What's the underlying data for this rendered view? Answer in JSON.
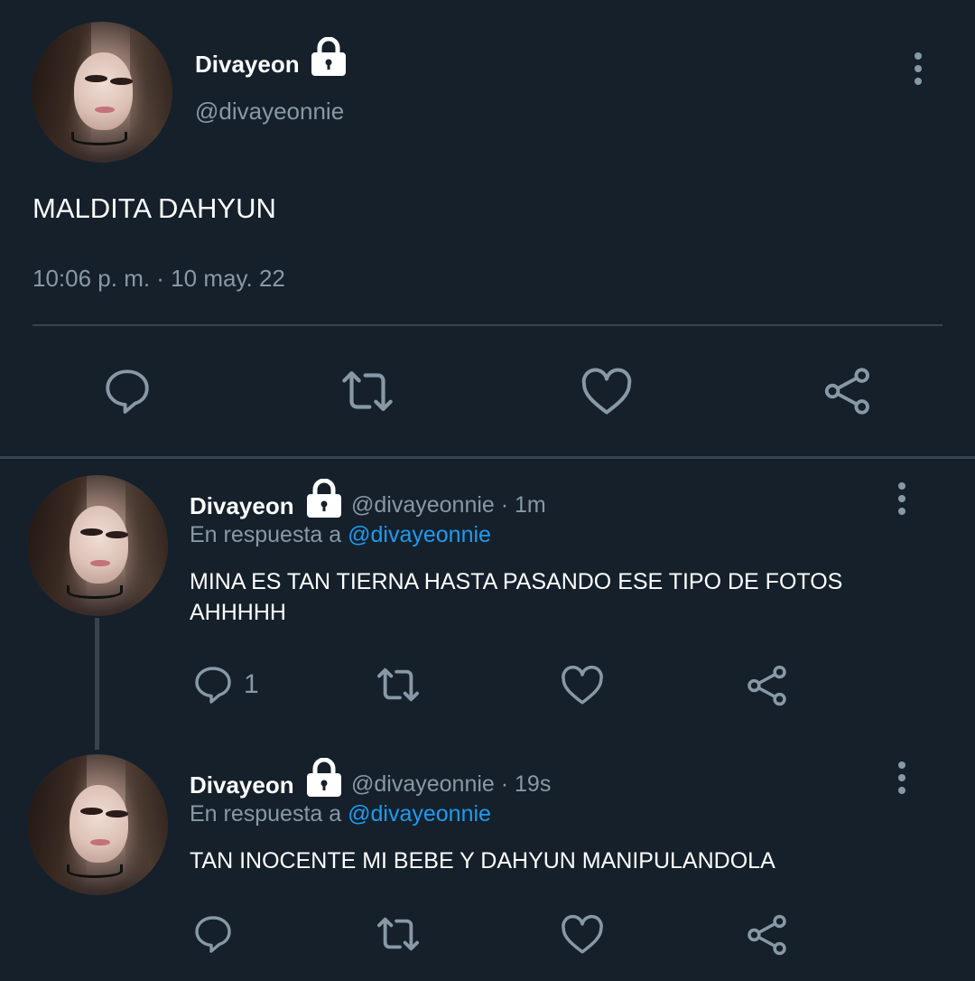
{
  "main_tweet": {
    "display_name": "Divayeon",
    "handle": "@divayeonnie",
    "text": "MALDITA DAHYUN",
    "timestamp": "10:06 p. m. · 10 may. 22"
  },
  "replies": [
    {
      "display_name": "Divayeon",
      "handle_time": "@divayeonnie · 1m",
      "in_reply_prefix": "En respuesta a ",
      "in_reply_mention": "@divayeonnie",
      "text_line1": "MINA ES TAN TIERNA HASTA PASANDO ESE TIPO DE FOTOS",
      "text_line2": "AHHHHH",
      "reply_count": "1"
    },
    {
      "display_name": "Divayeon",
      "handle_time": "@divayeonnie · 19s",
      "in_reply_prefix": "En respuesta a ",
      "in_reply_mention": "@divayeonnie",
      "text_line1": "TAN INOCENTE MI BEBE Y DAHYUN MANIPULANDOLA",
      "text_line2": "",
      "reply_count": ""
    }
  ],
  "icons": {
    "reply": "speech-bubble-icon",
    "retweet": "retweet-icon",
    "like": "heart-icon",
    "share": "share-icon",
    "lock": "lock-icon",
    "more": "vertical-dots-icon"
  },
  "colors": {
    "background": "#15202b",
    "secondary_text": "#8899a6",
    "divider": "#38444d",
    "mention": "#1d9bf0"
  }
}
